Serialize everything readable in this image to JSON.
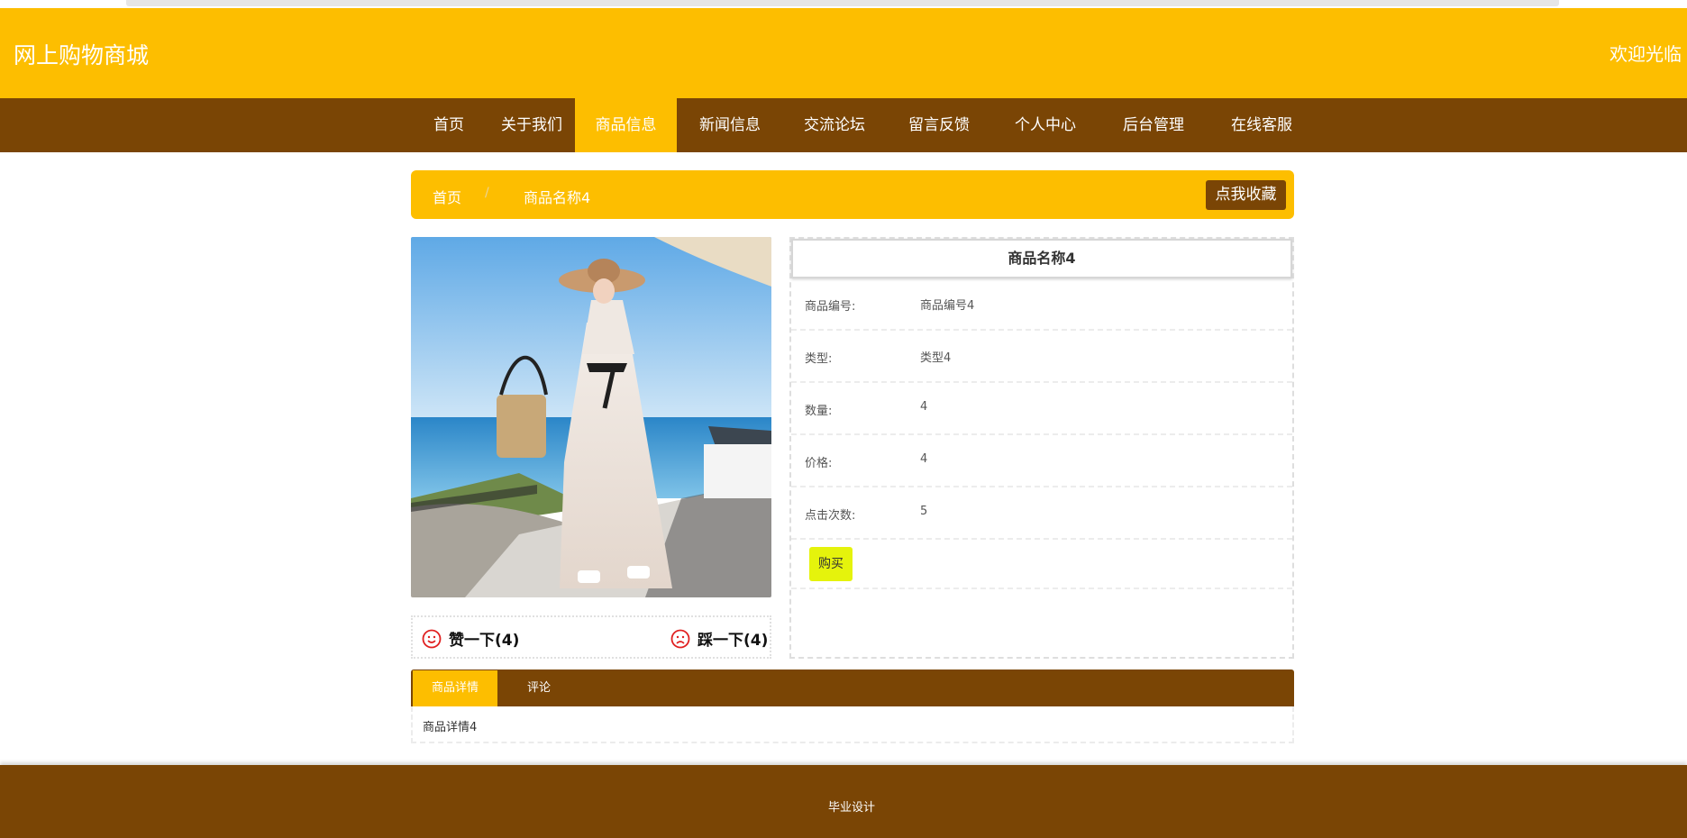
{
  "header": {
    "site_title": "网上购物商城",
    "welcome": "欢迎光临"
  },
  "nav": {
    "items": [
      {
        "label": "首页"
      },
      {
        "label": "关于我们"
      },
      {
        "label": "商品信息"
      },
      {
        "label": "新闻信息"
      },
      {
        "label": "交流论坛"
      },
      {
        "label": "留言反馈"
      },
      {
        "label": "个人中心"
      },
      {
        "label": "后台管理"
      },
      {
        "label": "在线客服"
      }
    ],
    "active_index": 2
  },
  "breadcrumb": {
    "home": "首页",
    "separator": "/",
    "current": "商品名称4"
  },
  "favorite_button": "点我收藏",
  "product": {
    "name": "商品名称4",
    "fields": [
      {
        "label": "商品编号:",
        "value": "商品编号4"
      },
      {
        "label": "类型:",
        "value": "类型4"
      },
      {
        "label": "数量:",
        "value": "4"
      },
      {
        "label": "价格:",
        "value": "4"
      },
      {
        "label": "点击次数:",
        "value": "5"
      }
    ],
    "buy_label": "购买"
  },
  "votes": {
    "like_label": "赞一下(4)",
    "dislike_label": "踩一下(4)"
  },
  "tabs": {
    "items": [
      {
        "label": "商品详情"
      },
      {
        "label": "评论"
      }
    ],
    "active_index": 0,
    "detail_text": "商品详情4"
  },
  "footer": {
    "text": "毕业设计"
  },
  "colors": {
    "primary_yellow": "#fdbe00",
    "primary_brown": "#7a4505",
    "buy_button": "#e5f30c",
    "vote_icon": "#e02020"
  }
}
